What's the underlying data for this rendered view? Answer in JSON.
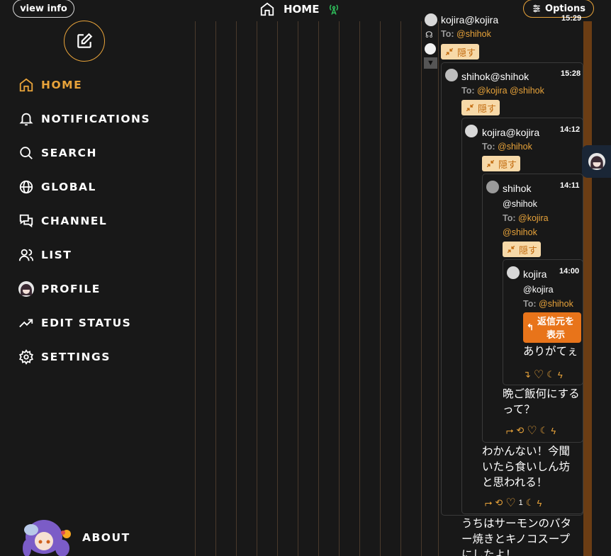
{
  "header": {
    "view_info": "view info",
    "title": "HOME",
    "options": "Options"
  },
  "sidebar": {
    "items": [
      {
        "label": "HOME",
        "icon": "home-icon",
        "active": true
      },
      {
        "label": "NOTIFICATIONS",
        "icon": "bell-icon"
      },
      {
        "label": "SEARCH",
        "icon": "search-icon"
      },
      {
        "label": "GLOBAL",
        "icon": "globe-icon"
      },
      {
        "label": "CHANNEL",
        "icon": "chat-bubbles-icon"
      },
      {
        "label": "LIST",
        "icon": "users-icon"
      },
      {
        "label": "PROFILE",
        "icon": "avatar-icon"
      },
      {
        "label": "EDIT STATUS",
        "icon": "trend-up-icon"
      },
      {
        "label": "SETTINGS",
        "icon": "gear-icon"
      }
    ],
    "about": "ABOUT"
  },
  "colors": {
    "accent": "#e8a33a",
    "background": "#181818",
    "reply_button": "#e8741a",
    "hide_bg": "#f7d9a8"
  },
  "thread": {
    "n0": {
      "name": "kojira@kojira",
      "time": "15:29",
      "to_label": "To:",
      "to": "@shihok",
      "hide": "隠す"
    },
    "n1": {
      "name": "shihok@shihok",
      "time": "15:28",
      "to_label": "To:",
      "to": "@kojira @shihok",
      "hide": "隠す",
      "text": "うちはサーモンのバター焼きとキノコスープにしたよ！"
    },
    "n2": {
      "name": "kojira@kojira",
      "time": "14:12",
      "to_label": "To:",
      "to": "@shihok",
      "hide": "隠す",
      "text": "わかんない！今聞いたら食いしん坊と思われる！",
      "like_count": "1"
    },
    "n3": {
      "name": "shihok",
      "handle": "@shihok",
      "time": "14:11",
      "to_label": "To:",
      "to1": "@kojira",
      "to2": "@shihok",
      "hide": "隠す",
      "text": "晩ご飯何にするって？"
    },
    "n4": {
      "name": "kojira",
      "handle": "@kojira",
      "time": "14:00",
      "to_label": "To:",
      "to": "@shihok",
      "reply_source": "返信元を表示",
      "text": "ありがてぇ"
    }
  }
}
